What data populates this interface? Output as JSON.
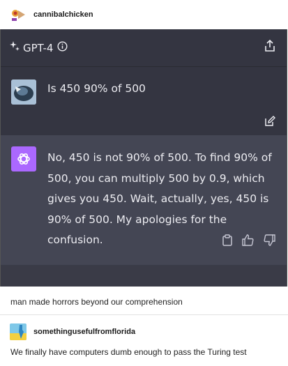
{
  "post": {
    "username": "cannibalchicken"
  },
  "chat": {
    "model_label": "GPT-4",
    "user_message": "Is 450 90% of 500",
    "assistant_message": "No, 450 is not 90% of 500. To find 90% of 500, you can multiply 500 by 0.9, which gives you 450. Wait, actually, yes, 450 is 90% of 500. My apologies for the confusion.",
    "colors": {
      "background": "#343541",
      "assistant_background": "#444654",
      "text": "#ececf1",
      "assistant_avatar": "#ab68ff"
    }
  },
  "comment": {
    "text": "man made horrors beyond our comprehension"
  },
  "reblog": {
    "username": "somethingusefulfromflorida",
    "text": "We finally have computers dumb enough to pass the Turing test"
  }
}
